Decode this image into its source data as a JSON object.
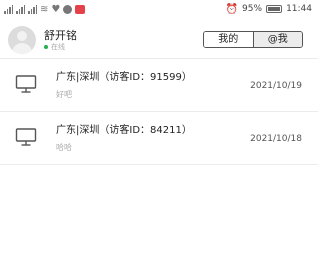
{
  "status_bar": {
    "battery": "95%",
    "time": "11:44"
  },
  "user": {
    "name": "舒开铭",
    "status": "在线"
  },
  "tabs": [
    {
      "label": "我的",
      "active": true
    },
    {
      "label": "@我",
      "active": false
    }
  ],
  "messages": [
    {
      "title": "广东|深圳（访客ID：91599）",
      "preview": "好吧",
      "date": "2021/10/19"
    },
    {
      "title": "广东|深圳（访客ID：84211）",
      "preview": "哈哈",
      "date": "2021/10/18"
    }
  ],
  "colors": {
    "online": "#22b14c",
    "notification": "#e5414b"
  },
  "icons": {
    "avatar": "user-avatar",
    "visitor": "desktop-monitor-icon"
  }
}
